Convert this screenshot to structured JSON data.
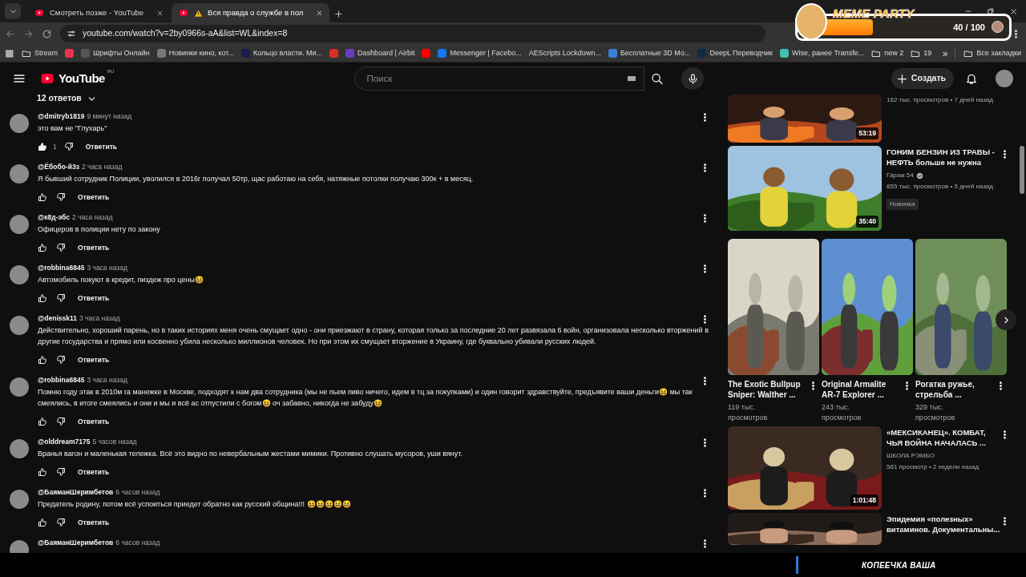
{
  "browser": {
    "tabs": [
      {
        "title": "Смотреть позже - YouTube",
        "selected": false,
        "warning": false
      },
      {
        "title": "Вся правда о службе в пол",
        "selected": true,
        "warning": true
      }
    ],
    "url": "youtube.com/watch?v=2by0966s-aA&list=WL&index=8",
    "bookmarks": [
      {
        "kind": "folder",
        "label": "Stream"
      },
      {
        "kind": "site",
        "color": "#e8334a"
      },
      {
        "kind": "site",
        "label": "Шрифты Онлайн",
        "color": "#555555"
      },
      {
        "kind": "site",
        "label": "Новинки кино, кот...",
        "color": "#777777"
      },
      {
        "kind": "site",
        "label": "Кольцо власти. Ми...",
        "color": "#1c1b4d"
      },
      {
        "kind": "site",
        "color": "#d93025"
      },
      {
        "kind": "site",
        "label": "Dashboard | Airbit",
        "color": "#6a3fc1"
      },
      {
        "kind": "site",
        "color": "#ff0000"
      },
      {
        "kind": "site",
        "label": "Messenger | Facebo...",
        "color": "#1877f2"
      },
      {
        "kind": "site",
        "label": "AEScripts Lockdown..."
      },
      {
        "kind": "site",
        "label": "Бесплатные 3D Мо...",
        "color": "#3d7fd6"
      },
      {
        "kind": "site",
        "label": "DeepL Переводчик",
        "color": "#0f2b46"
      },
      {
        "kind": "site",
        "label": "Wise, ранее Transfe...",
        "color": "#3fbfb0"
      },
      {
        "kind": "folder",
        "label": "new 2"
      },
      {
        "kind": "folder",
        "label": "19"
      }
    ],
    "bookmarks_more": "»",
    "all_bookmarks": "Все закладки"
  },
  "overlay": {
    "title": "MEME PARTY",
    "level": 0.4,
    "count": "40 / 100"
  },
  "youtube": {
    "logo": "YouTube",
    "region": "RU",
    "search": {
      "placeholder": "Поиск"
    },
    "create_button": "Создать"
  },
  "replies_toggle": "12 ответов",
  "comments": [
    {
      "author": "@dmitryb1819",
      "time": "9 минут назад",
      "text": "это вам не \"Глухарь\"",
      "liked": true,
      "likes": "1",
      "reply": "Ответить"
    },
    {
      "author": "@Ёбобо-й3з",
      "time": "2 часа назад",
      "text": "Я бывший сотрудник Полиции, уволился в 2016г получал 50тр, щас работаю на себя, натяжные потолки получаю 300к + в месяц.",
      "liked": false,
      "reply": "Ответить"
    },
    {
      "author": "@к8д-эбс",
      "time": "2 часа назад",
      "text": "Офицеров в полиции нету по закону",
      "liked": false,
      "reply": "Ответить"
    },
    {
      "author": "@robbina6845",
      "time": "3 часа назад",
      "text": "Автомобиль покуют в кредит, пиздеж про цены😆",
      "liked": false,
      "reply": "Ответить"
    },
    {
      "author": "@denissk11",
      "time": "3 часа назад",
      "text": "Действительно, хороший парень, но в таких историях меня очень смущает одно - они приезжают в страну, которая только за последние 20 лет развязала 6 войн, организовала несколько вторжений в другие государства и прямо или косвенно убила несколько миллионов человек. Но при этом их смущает вторжение в Украину, где буквально убивали русских людей.",
      "liked": false,
      "reply": "Ответить"
    },
    {
      "author": "@robbina6845",
      "time": "3 часа назад",
      "text": "Помню году этак в 2010м га манежке в Москве, подходят к нам два сотрудника (мы не пьем пиво ничего, идем в тц за покупками) и один говорит здравствуйте, предъявите ваши деньги😆 мы так смеялись, в итоге смеялись и они и мы и всё ас отпустили с богом😆 оч забавно, никогда не забуду😆",
      "liked": false,
      "reply": "Ответить"
    },
    {
      "author": "@olddream7175",
      "time": "5 часов назад",
      "text": "Вранья вагон и маленькая тележка. Всё это видно по невербальным жестами мимики. Противно слушать мусоров, уши вянут.",
      "liked": false,
      "reply": "Ответить"
    },
    {
      "author": "@БаяманШеримбетов",
      "time": "6 часов назад",
      "text": "Предатель родину, потом  всё успоиться приедет обратно как русский община!!!  😆😆😆😆😆",
      "liked": false,
      "reply": "Ответить"
    },
    {
      "author": "@БаяманШеримбетов",
      "time": "6 часов назад"
    }
  ],
  "sidebar": {
    "videos_top": [
      {
        "meta": "162 тыс. просмотров • 7 дней назад",
        "duration": "53:19"
      },
      {
        "title": "ГОНИМ БЕНЗИН ИЗ ТРАВЫ - НЕФТЬ больше не нужна",
        "channel": "Гараж 54",
        "verified": true,
        "meta": "855 тыс. просмотров • 5 дней назад",
        "badge": "Новинка",
        "duration": "35:40"
      }
    ],
    "shorts": [
      {
        "title": "The Exotic Bullpup Sniper: Walther ...",
        "views": "119 тыс. просмотров"
      },
      {
        "title": "Original Armalite AR-7 Explorer ...",
        "views": "243 тыс. просмотров"
      },
      {
        "title": "Рогатка ружье, стрельба ...",
        "views": "329 тыс. просмотров"
      }
    ],
    "videos_bottom": [
      {
        "title": "«МЕКСИКАНЕЦ». КОМБАТ, ЧЬЯ ВОЙНА НАЧАЛАСЬ ...",
        "channel": "ШКОЛА РЭМБО",
        "verified": false,
        "meta": "581 просмотр • 2 недели назад",
        "duration": "1:01:48"
      },
      {
        "title": "Эпидемия «полезных» витаминов. Документальны..."
      }
    ]
  },
  "ticker": {
    "text": "КОПЕЕЧКА ВАША"
  }
}
